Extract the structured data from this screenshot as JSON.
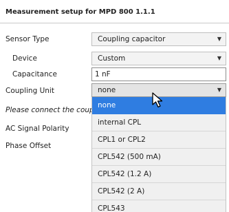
{
  "title": "Measurement setup for MPD 800 1.1.1",
  "rows": {
    "sensor_type": {
      "label": "Sensor Type",
      "value": "Coupling capacitor"
    },
    "device": {
      "label": "Device",
      "value": "Custom"
    },
    "capacitance": {
      "label": "Capacitance",
      "value": "1 nF"
    },
    "coupling_unit": {
      "label": "Coupling Unit",
      "value": "none"
    },
    "notice": {
      "label": "Please connect the coupling"
    },
    "ac_signal_polarity": {
      "label": "AC Signal Polarity"
    },
    "phase_offset": {
      "label": "Phase Offset"
    }
  },
  "dropdown": {
    "options": [
      "none",
      "internal CPL",
      "CPL1 or CPL2",
      "CPL542 (500 mA)",
      "CPL542 (1.2 A)",
      "CPL542 (2 A)",
      "CPL543"
    ],
    "selected_index": 0
  },
  "arrow_glyph": "▼",
  "colors": {
    "selected": "#2f7de1",
    "dropdown_bg": "#f0f0f0"
  },
  "icons": {
    "cursor": "mouse-pointer-icon",
    "dropdown_arrow": "chevron-down-icon"
  }
}
